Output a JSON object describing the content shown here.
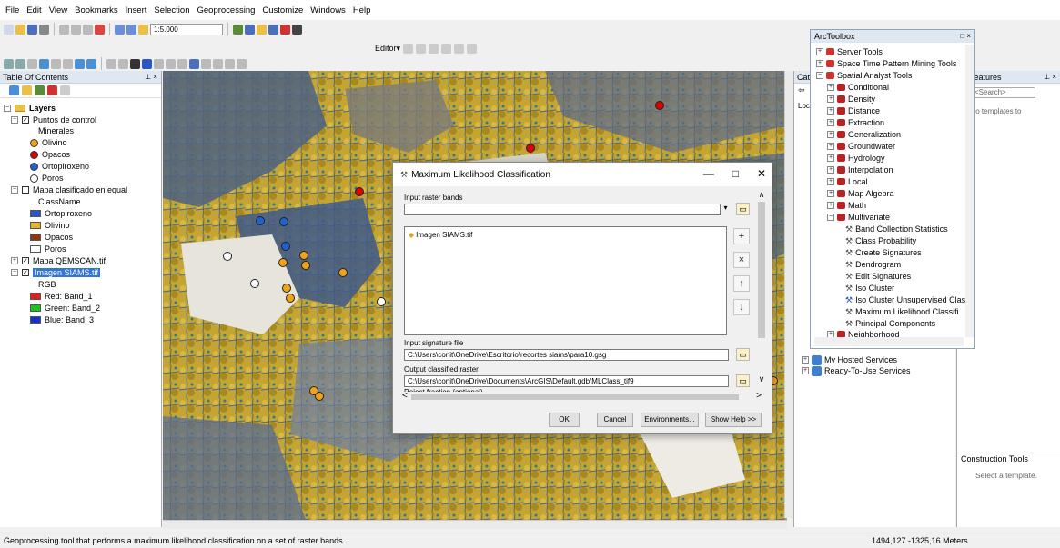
{
  "menu": [
    "File",
    "Edit",
    "View",
    "Bookmarks",
    "Insert",
    "Selection",
    "Geoprocessing",
    "Customize",
    "Windows",
    "Help"
  ],
  "toolbar": {
    "scale": "1:5.000",
    "editor_label": "Editor▾"
  },
  "toc": {
    "title": "Table Of Contents",
    "layers_label": "Layers",
    "puntos_layer": "Puntos de control",
    "minerales_field": "Minerales",
    "puntos_items": [
      {
        "label": "Olivino",
        "color": "#f0a31a"
      },
      {
        "label": "Opacos",
        "color": "#e00000"
      },
      {
        "label": "Ortopiroxeno",
        "color": "#2060d0"
      },
      {
        "label": "Poros",
        "color": "#ffffff"
      }
    ],
    "mapa_layer": "Mapa clasificado en equal",
    "classname_field": "ClassName",
    "mapa_items": [
      {
        "label": "Ortopiroxeno",
        "color": "#2a57c7"
      },
      {
        "label": "Olivino",
        "color": "#e9b02b"
      },
      {
        "label": "Opacos",
        "color": "#8a3a1a"
      },
      {
        "label": "Poros",
        "color": "#ffffff"
      }
    ],
    "qemscan_layer": "Mapa QEMSCAN.tif",
    "siams_layer": "Imagen SIAMS.tif",
    "rgb_label": "RGB",
    "bands": [
      {
        "label": "Red:  Band_1",
        "color": "#e02020"
      },
      {
        "label": "Green: Band_2",
        "color": "#20c020"
      },
      {
        "label": "Blue:  Band_3",
        "color": "#1a2fd0"
      }
    ]
  },
  "catalog": {
    "title_fragment": "Cat",
    "loc_fragment": "Loc"
  },
  "create_features": {
    "title": "te Features",
    "search_placeholder": "<Search>",
    "no_templates": "are no templates to",
    "construction_tools": "Construction Tools",
    "select_template": "Select a template."
  },
  "arctoolbox": {
    "title": "ArcToolbox",
    "server_tools": "Server Tools",
    "space_time": "Space Time Pattern Mining Tools",
    "spatial_analyst": "Spatial Analyst Tools",
    "sa_items": [
      "Conditional",
      "Density",
      "Distance",
      "Extraction",
      "Generalization",
      "Groundwater",
      "Hydrology",
      "Interpolation",
      "Local",
      "Map Algebra",
      "Math",
      "Multivariate"
    ],
    "multivariate_tools": [
      "Band Collection Statistics",
      "Class Probability",
      "Create Signatures",
      "Dendrogram",
      "Edit Signatures",
      "Iso Cluster",
      "Iso Cluster Unsupervised Clas",
      "Maximum Likelihood Classifi",
      "Principal Components"
    ],
    "neighborhood": "Neighborhood"
  },
  "catalog_tree": [
    "My Hosted Services",
    "Ready-To-Use Services"
  ],
  "dialog": {
    "title": "Maximum Likelihood Classification",
    "input_bands_label": "Input raster bands",
    "band_item": "Imagen SIAMS.tif",
    "signature_label": "Input signature file",
    "signature_value": "C:\\Users\\conit\\OneDrive\\Escritorio\\recortes siams\\para10.gsg",
    "output_label": "Output classified raster",
    "output_value": "C:\\Users\\conit\\OneDrive\\Documents\\ArcGIS\\Default.gdb\\MLClass_tif9",
    "reject_label": "Reject fraction (optional)",
    "buttons": {
      "ok": "OK",
      "cancel": "Cancel",
      "env": "Environments...",
      "help": "Show Help >>"
    }
  },
  "status": {
    "message": "Geoprocessing tool that performs a maximum likelihood classification on a set of raster bands.",
    "coords": "1494,127  -1325,16 Meters"
  }
}
